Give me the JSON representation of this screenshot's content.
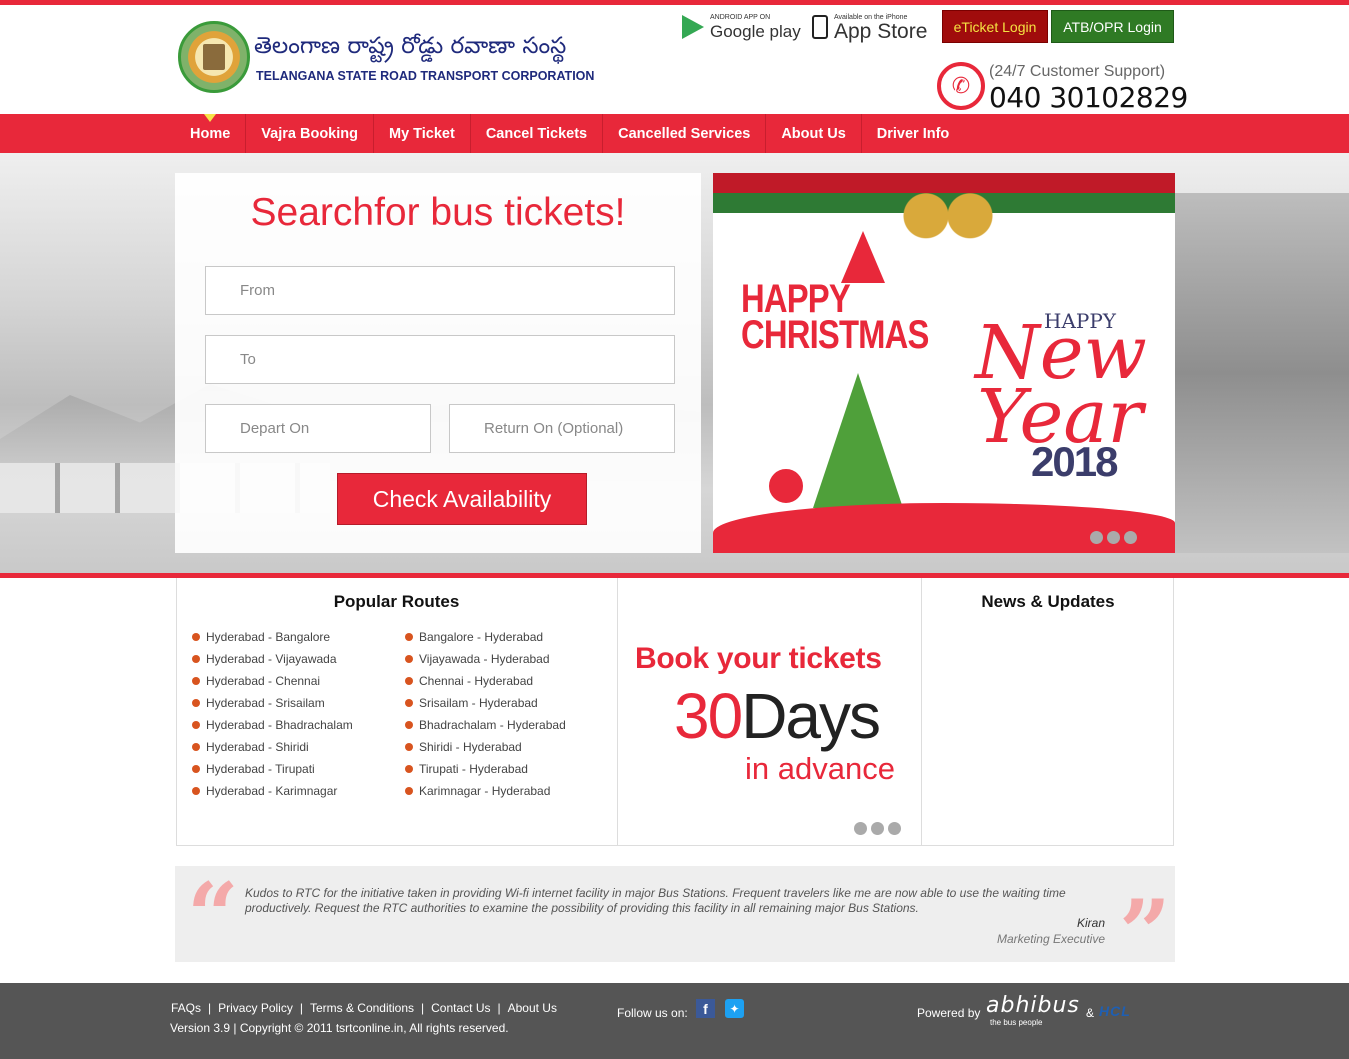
{
  "header": {
    "logo_telugu": "తెలంగాణ రాష్ట్ర రోడ్డు రవాణా సంస్థ",
    "logo_english": "TELANGANA STATE ROAD TRANSPORT CORPORATION",
    "google_play_small": "ANDROID APP ON",
    "google_play_label": "Google play",
    "app_store_small": "Available on the iPhone",
    "app_store_label": "App Store",
    "eticket_login": "eTicket Login",
    "atb_login": "ATB/OPR Login",
    "support_label": "(24/7 Customer Support)",
    "support_phone": "040 30102829"
  },
  "nav": {
    "items": [
      {
        "label": "Home",
        "active": true
      },
      {
        "label": "Vajra Booking"
      },
      {
        "label": "My Ticket"
      },
      {
        "label": "Cancel Tickets"
      },
      {
        "label": "Cancelled Services"
      },
      {
        "label": "About Us"
      },
      {
        "label": "Driver Info"
      }
    ]
  },
  "search": {
    "title": "Searchfor bus tickets!",
    "from_placeholder": "From",
    "to_placeholder": "To",
    "depart_placeholder": "Depart On",
    "return_placeholder": "Return On (Optional)",
    "check_button": "Check Availability"
  },
  "banner": {
    "happy_christmas": "HAPPY CHRISTMAS",
    "happy": "HAPPY",
    "new_year": "New Year",
    "year": "2018"
  },
  "routes": {
    "title": "Popular Routes",
    "left": [
      "Hyderabad - Bangalore",
      "Hyderabad - Vijayawada",
      "Hyderabad - Chennai",
      "Hyderabad - Srisailam",
      "Hyderabad - Bhadrachalam",
      "Hyderabad - Shiridi",
      "Hyderabad - Tirupati",
      "Hyderabad - Karimnagar"
    ],
    "right": [
      "Bangalore - Hyderabad",
      "Vijayawada - Hyderabad",
      "Chennai - Hyderabad",
      "Srisailam - Hyderabad",
      "Bhadrachalam - Hyderabad",
      "Shiridi - Hyderabad",
      "Tirupati - Hyderabad",
      "Karimnagar - Hyderabad"
    ]
  },
  "promo": {
    "line1": "Book your tickets",
    "num": "30",
    "days": "Days",
    "line3": "in advance"
  },
  "news": {
    "title": "News & Updates"
  },
  "testimonial": {
    "text": "Kudos to RTC for the initiative taken in providing Wi-fi internet facility in major Bus Stations. Frequent travelers like me are now able to use the waiting time productively. Request the RTC authorities to examine the possibility of providing this facility in all remaining major Bus Stations.",
    "name": "Kiran",
    "role": "Marketing Executive"
  },
  "footer": {
    "links": [
      "FAQs",
      "Privacy Policy",
      "Terms & Conditions",
      "Contact Us",
      "About Us"
    ],
    "copyright": "Version 3.9 | Copyright © 2011 tsrtconline.in, All rights reserved.",
    "follow_us": "Follow us on:",
    "powered_by": "Powered by",
    "abhibus": "abhibus",
    "abhibus_tagline": "the bus people",
    "amp": "&",
    "hcl": "HCL"
  },
  "colors": {
    "brand_red": "#e8283a",
    "eticket_bg": "#a00c0c",
    "atb_bg": "#2f7a24"
  }
}
